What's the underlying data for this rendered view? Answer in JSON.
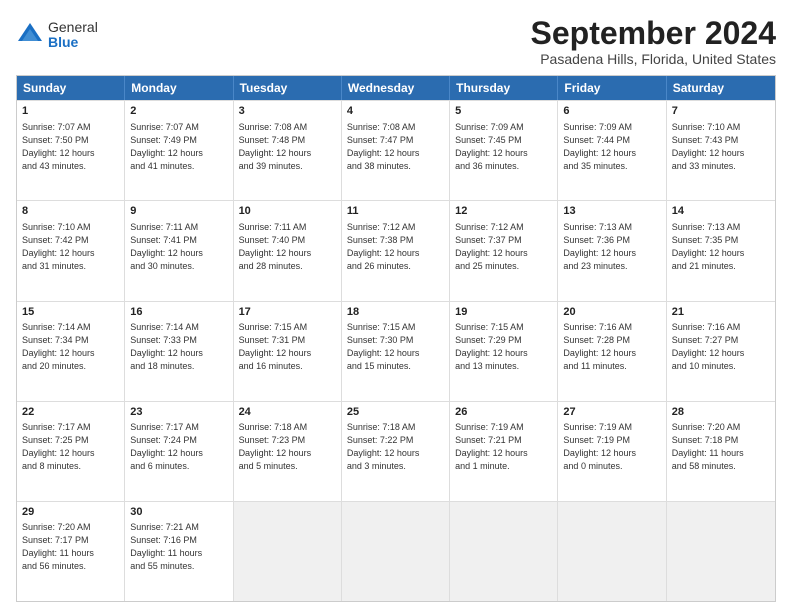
{
  "logo": {
    "general": "General",
    "blue": "Blue"
  },
  "title": "September 2024",
  "subtitle": "Pasadena Hills, Florida, United States",
  "header_days": [
    "Sunday",
    "Monday",
    "Tuesday",
    "Wednesday",
    "Thursday",
    "Friday",
    "Saturday"
  ],
  "weeks": [
    [
      {
        "day": "1",
        "lines": [
          "Sunrise: 7:07 AM",
          "Sunset: 7:50 PM",
          "Daylight: 12 hours",
          "and 43 minutes."
        ]
      },
      {
        "day": "2",
        "lines": [
          "Sunrise: 7:07 AM",
          "Sunset: 7:49 PM",
          "Daylight: 12 hours",
          "and 41 minutes."
        ]
      },
      {
        "day": "3",
        "lines": [
          "Sunrise: 7:08 AM",
          "Sunset: 7:48 PM",
          "Daylight: 12 hours",
          "and 39 minutes."
        ]
      },
      {
        "day": "4",
        "lines": [
          "Sunrise: 7:08 AM",
          "Sunset: 7:47 PM",
          "Daylight: 12 hours",
          "and 38 minutes."
        ]
      },
      {
        "day": "5",
        "lines": [
          "Sunrise: 7:09 AM",
          "Sunset: 7:45 PM",
          "Daylight: 12 hours",
          "and 36 minutes."
        ]
      },
      {
        "day": "6",
        "lines": [
          "Sunrise: 7:09 AM",
          "Sunset: 7:44 PM",
          "Daylight: 12 hours",
          "and 35 minutes."
        ]
      },
      {
        "day": "7",
        "lines": [
          "Sunrise: 7:10 AM",
          "Sunset: 7:43 PM",
          "Daylight: 12 hours",
          "and 33 minutes."
        ]
      }
    ],
    [
      {
        "day": "8",
        "lines": [
          "Sunrise: 7:10 AM",
          "Sunset: 7:42 PM",
          "Daylight: 12 hours",
          "and 31 minutes."
        ]
      },
      {
        "day": "9",
        "lines": [
          "Sunrise: 7:11 AM",
          "Sunset: 7:41 PM",
          "Daylight: 12 hours",
          "and 30 minutes."
        ]
      },
      {
        "day": "10",
        "lines": [
          "Sunrise: 7:11 AM",
          "Sunset: 7:40 PM",
          "Daylight: 12 hours",
          "and 28 minutes."
        ]
      },
      {
        "day": "11",
        "lines": [
          "Sunrise: 7:12 AM",
          "Sunset: 7:38 PM",
          "Daylight: 12 hours",
          "and 26 minutes."
        ]
      },
      {
        "day": "12",
        "lines": [
          "Sunrise: 7:12 AM",
          "Sunset: 7:37 PM",
          "Daylight: 12 hours",
          "and 25 minutes."
        ]
      },
      {
        "day": "13",
        "lines": [
          "Sunrise: 7:13 AM",
          "Sunset: 7:36 PM",
          "Daylight: 12 hours",
          "and 23 minutes."
        ]
      },
      {
        "day": "14",
        "lines": [
          "Sunrise: 7:13 AM",
          "Sunset: 7:35 PM",
          "Daylight: 12 hours",
          "and 21 minutes."
        ]
      }
    ],
    [
      {
        "day": "15",
        "lines": [
          "Sunrise: 7:14 AM",
          "Sunset: 7:34 PM",
          "Daylight: 12 hours",
          "and 20 minutes."
        ]
      },
      {
        "day": "16",
        "lines": [
          "Sunrise: 7:14 AM",
          "Sunset: 7:33 PM",
          "Daylight: 12 hours",
          "and 18 minutes."
        ]
      },
      {
        "day": "17",
        "lines": [
          "Sunrise: 7:15 AM",
          "Sunset: 7:31 PM",
          "Daylight: 12 hours",
          "and 16 minutes."
        ]
      },
      {
        "day": "18",
        "lines": [
          "Sunrise: 7:15 AM",
          "Sunset: 7:30 PM",
          "Daylight: 12 hours",
          "and 15 minutes."
        ]
      },
      {
        "day": "19",
        "lines": [
          "Sunrise: 7:15 AM",
          "Sunset: 7:29 PM",
          "Daylight: 12 hours",
          "and 13 minutes."
        ]
      },
      {
        "day": "20",
        "lines": [
          "Sunrise: 7:16 AM",
          "Sunset: 7:28 PM",
          "Daylight: 12 hours",
          "and 11 minutes."
        ]
      },
      {
        "day": "21",
        "lines": [
          "Sunrise: 7:16 AM",
          "Sunset: 7:27 PM",
          "Daylight: 12 hours",
          "and 10 minutes."
        ]
      }
    ],
    [
      {
        "day": "22",
        "lines": [
          "Sunrise: 7:17 AM",
          "Sunset: 7:25 PM",
          "Daylight: 12 hours",
          "and 8 minutes."
        ]
      },
      {
        "day": "23",
        "lines": [
          "Sunrise: 7:17 AM",
          "Sunset: 7:24 PM",
          "Daylight: 12 hours",
          "and 6 minutes."
        ]
      },
      {
        "day": "24",
        "lines": [
          "Sunrise: 7:18 AM",
          "Sunset: 7:23 PM",
          "Daylight: 12 hours",
          "and 5 minutes."
        ]
      },
      {
        "day": "25",
        "lines": [
          "Sunrise: 7:18 AM",
          "Sunset: 7:22 PM",
          "Daylight: 12 hours",
          "and 3 minutes."
        ]
      },
      {
        "day": "26",
        "lines": [
          "Sunrise: 7:19 AM",
          "Sunset: 7:21 PM",
          "Daylight: 12 hours",
          "and 1 minute."
        ]
      },
      {
        "day": "27",
        "lines": [
          "Sunrise: 7:19 AM",
          "Sunset: 7:19 PM",
          "Daylight: 12 hours",
          "and 0 minutes."
        ]
      },
      {
        "day": "28",
        "lines": [
          "Sunrise: 7:20 AM",
          "Sunset: 7:18 PM",
          "Daylight: 11 hours",
          "and 58 minutes."
        ]
      }
    ],
    [
      {
        "day": "29",
        "lines": [
          "Sunrise: 7:20 AM",
          "Sunset: 7:17 PM",
          "Daylight: 11 hours",
          "and 56 minutes."
        ]
      },
      {
        "day": "30",
        "lines": [
          "Sunrise: 7:21 AM",
          "Sunset: 7:16 PM",
          "Daylight: 11 hours",
          "and 55 minutes."
        ]
      },
      {
        "day": "",
        "lines": []
      },
      {
        "day": "",
        "lines": []
      },
      {
        "day": "",
        "lines": []
      },
      {
        "day": "",
        "lines": []
      },
      {
        "day": "",
        "lines": []
      }
    ]
  ]
}
